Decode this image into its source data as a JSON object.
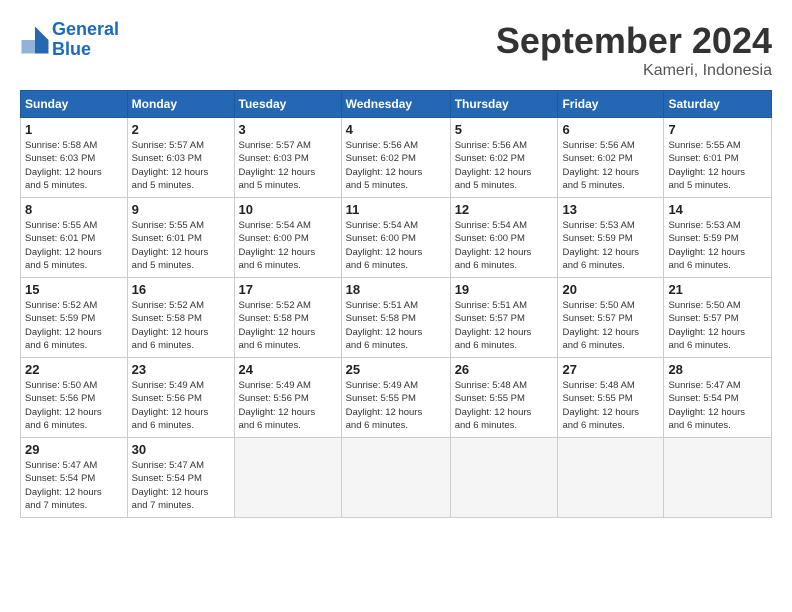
{
  "logo": {
    "line1": "General",
    "line2": "Blue"
  },
  "title": "September 2024",
  "subtitle": "Kameri, Indonesia",
  "headers": [
    "Sunday",
    "Monday",
    "Tuesday",
    "Wednesday",
    "Thursday",
    "Friday",
    "Saturday"
  ],
  "weeks": [
    [
      {
        "day": "1",
        "info": "Sunrise: 5:58 AM\nSunset: 6:03 PM\nDaylight: 12 hours\nand 5 minutes."
      },
      {
        "day": "2",
        "info": "Sunrise: 5:57 AM\nSunset: 6:03 PM\nDaylight: 12 hours\nand 5 minutes."
      },
      {
        "day": "3",
        "info": "Sunrise: 5:57 AM\nSunset: 6:03 PM\nDaylight: 12 hours\nand 5 minutes."
      },
      {
        "day": "4",
        "info": "Sunrise: 5:56 AM\nSunset: 6:02 PM\nDaylight: 12 hours\nand 5 minutes."
      },
      {
        "day": "5",
        "info": "Sunrise: 5:56 AM\nSunset: 6:02 PM\nDaylight: 12 hours\nand 5 minutes."
      },
      {
        "day": "6",
        "info": "Sunrise: 5:56 AM\nSunset: 6:02 PM\nDaylight: 12 hours\nand 5 minutes."
      },
      {
        "day": "7",
        "info": "Sunrise: 5:55 AM\nSunset: 6:01 PM\nDaylight: 12 hours\nand 5 minutes."
      }
    ],
    [
      {
        "day": "8",
        "info": "Sunrise: 5:55 AM\nSunset: 6:01 PM\nDaylight: 12 hours\nand 5 minutes."
      },
      {
        "day": "9",
        "info": "Sunrise: 5:55 AM\nSunset: 6:01 PM\nDaylight: 12 hours\nand 5 minutes."
      },
      {
        "day": "10",
        "info": "Sunrise: 5:54 AM\nSunset: 6:00 PM\nDaylight: 12 hours\nand 6 minutes."
      },
      {
        "day": "11",
        "info": "Sunrise: 5:54 AM\nSunset: 6:00 PM\nDaylight: 12 hours\nand 6 minutes."
      },
      {
        "day": "12",
        "info": "Sunrise: 5:54 AM\nSunset: 6:00 PM\nDaylight: 12 hours\nand 6 minutes."
      },
      {
        "day": "13",
        "info": "Sunrise: 5:53 AM\nSunset: 5:59 PM\nDaylight: 12 hours\nand 6 minutes."
      },
      {
        "day": "14",
        "info": "Sunrise: 5:53 AM\nSunset: 5:59 PM\nDaylight: 12 hours\nand 6 minutes."
      }
    ],
    [
      {
        "day": "15",
        "info": "Sunrise: 5:52 AM\nSunset: 5:59 PM\nDaylight: 12 hours\nand 6 minutes."
      },
      {
        "day": "16",
        "info": "Sunrise: 5:52 AM\nSunset: 5:58 PM\nDaylight: 12 hours\nand 6 minutes."
      },
      {
        "day": "17",
        "info": "Sunrise: 5:52 AM\nSunset: 5:58 PM\nDaylight: 12 hours\nand 6 minutes."
      },
      {
        "day": "18",
        "info": "Sunrise: 5:51 AM\nSunset: 5:58 PM\nDaylight: 12 hours\nand 6 minutes."
      },
      {
        "day": "19",
        "info": "Sunrise: 5:51 AM\nSunset: 5:57 PM\nDaylight: 12 hours\nand 6 minutes."
      },
      {
        "day": "20",
        "info": "Sunrise: 5:50 AM\nSunset: 5:57 PM\nDaylight: 12 hours\nand 6 minutes."
      },
      {
        "day": "21",
        "info": "Sunrise: 5:50 AM\nSunset: 5:57 PM\nDaylight: 12 hours\nand 6 minutes."
      }
    ],
    [
      {
        "day": "22",
        "info": "Sunrise: 5:50 AM\nSunset: 5:56 PM\nDaylight: 12 hours\nand 6 minutes."
      },
      {
        "day": "23",
        "info": "Sunrise: 5:49 AM\nSunset: 5:56 PM\nDaylight: 12 hours\nand 6 minutes."
      },
      {
        "day": "24",
        "info": "Sunrise: 5:49 AM\nSunset: 5:56 PM\nDaylight: 12 hours\nand 6 minutes."
      },
      {
        "day": "25",
        "info": "Sunrise: 5:49 AM\nSunset: 5:55 PM\nDaylight: 12 hours\nand 6 minutes."
      },
      {
        "day": "26",
        "info": "Sunrise: 5:48 AM\nSunset: 5:55 PM\nDaylight: 12 hours\nand 6 minutes."
      },
      {
        "day": "27",
        "info": "Sunrise: 5:48 AM\nSunset: 5:55 PM\nDaylight: 12 hours\nand 6 minutes."
      },
      {
        "day": "28",
        "info": "Sunrise: 5:47 AM\nSunset: 5:54 PM\nDaylight: 12 hours\nand 6 minutes."
      }
    ],
    [
      {
        "day": "29",
        "info": "Sunrise: 5:47 AM\nSunset: 5:54 PM\nDaylight: 12 hours\nand 7 minutes."
      },
      {
        "day": "30",
        "info": "Sunrise: 5:47 AM\nSunset: 5:54 PM\nDaylight: 12 hours\nand 7 minutes."
      },
      {
        "day": "",
        "info": ""
      },
      {
        "day": "",
        "info": ""
      },
      {
        "day": "",
        "info": ""
      },
      {
        "day": "",
        "info": ""
      },
      {
        "day": "",
        "info": ""
      }
    ]
  ]
}
